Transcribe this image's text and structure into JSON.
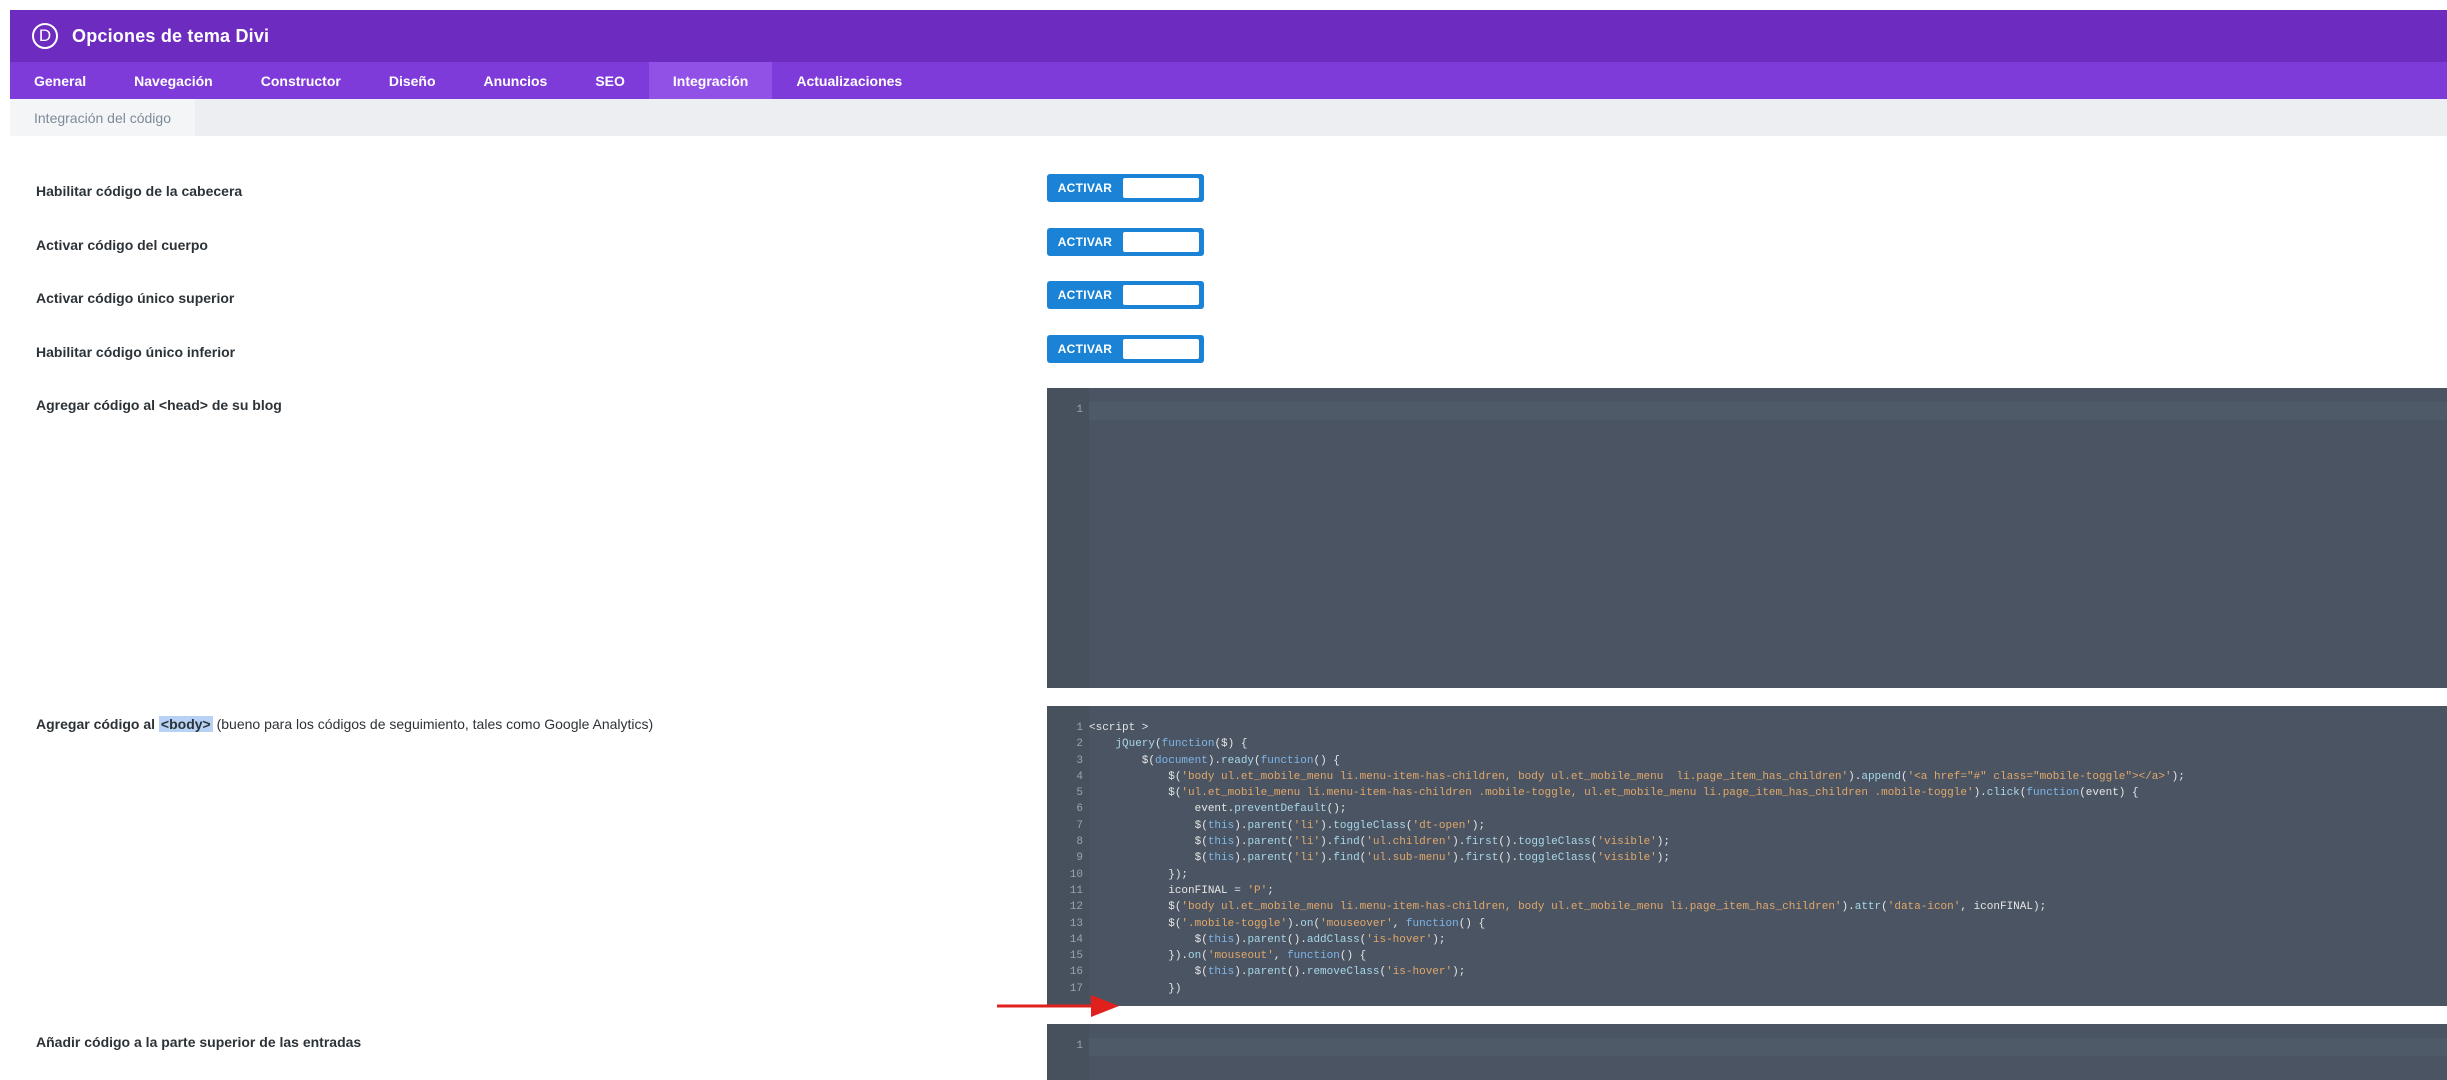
{
  "app": {
    "logo_letter": "D",
    "title": "Opciones de tema Divi"
  },
  "tabs": [
    {
      "label": "General"
    },
    {
      "label": "Navegación"
    },
    {
      "label": "Constructor"
    },
    {
      "label": "Diseño"
    },
    {
      "label": "Anuncios"
    },
    {
      "label": "SEO"
    },
    {
      "label": "Integración",
      "active": true
    },
    {
      "label": "Actualizaciones"
    }
  ],
  "subtab": {
    "label": "Integración del código"
  },
  "settings": {
    "header_code": {
      "label": "Habilitar código de la cabecera",
      "toggle": "ACTIVAR"
    },
    "body_code": {
      "label": "Activar código del cuerpo",
      "toggle": "ACTIVAR"
    },
    "top_single": {
      "label": "Activar código único superior",
      "toggle": "ACTIVAR"
    },
    "bottom_single": {
      "label": "Habilitar código único inferior",
      "toggle": "ACTIVAR"
    },
    "head_blog": {
      "label": "Agregar código al <head> de su blog",
      "line_number": "1"
    },
    "body_field": {
      "label_prefix": "Agregar código al ",
      "label_tag": "<body>",
      "label_suffix": " (bueno para los códigos de seguimiento, tales como Google Analytics)"
    },
    "posts_top": {
      "label": "Añadir código a la parte superior de las entradas",
      "line_number": "1"
    }
  },
  "code_lines": [
    {
      "n": "1",
      "text": "<script >"
    },
    {
      "n": "2",
      "text": "    jQuery(function($) {"
    },
    {
      "n": "3",
      "text": "        $(document).ready(function() {"
    },
    {
      "n": "4",
      "text": "            $('body ul.et_mobile_menu li.menu-item-has-children, body ul.et_mobile_menu  li.page_item_has_children').append('<a href=\"#\" class=\"mobile-toggle\"></a>');"
    },
    {
      "n": "5",
      "text": "            $('ul.et_mobile_menu li.menu-item-has-children .mobile-toggle, ul.et_mobile_menu li.page_item_has_children .mobile-toggle').click(function(event) {"
    },
    {
      "n": "6",
      "text": "                event.preventDefault();"
    },
    {
      "n": "7",
      "text": "                $(this).parent('li').toggleClass('dt-open');"
    },
    {
      "n": "8",
      "text": "                $(this).parent('li').find('ul.children').first().toggleClass('visible');"
    },
    {
      "n": "9",
      "text": "                $(this).parent('li').find('ul.sub-menu').first().toggleClass('visible');"
    },
    {
      "n": "10",
      "text": "            });"
    },
    {
      "n": "11",
      "text": "            iconFINAL = 'P';"
    },
    {
      "n": "12",
      "text": "            $('body ul.et_mobile_menu li.menu-item-has-children, body ul.et_mobile_menu li.page_item_has_children').attr('data-icon', iconFINAL);"
    },
    {
      "n": "13",
      "text": "            $('.mobile-toggle').on('mouseover', function() {"
    },
    {
      "n": "14",
      "text": "                $(this).parent().addClass('is-hover');"
    },
    {
      "n": "15",
      "text": "            }).on('mouseout', function() {"
    },
    {
      "n": "16",
      "text": "                $(this).parent().removeClass('is-hover');"
    },
    {
      "n": "17",
      "text": "            })"
    }
  ],
  "colors": {
    "header": "#6e2bbf",
    "tabs": "#7f3bd9",
    "active_tab": "#9150e6",
    "toggle": "#1b83d6",
    "editor": "#4a5462",
    "arrow": "#e0201d"
  }
}
